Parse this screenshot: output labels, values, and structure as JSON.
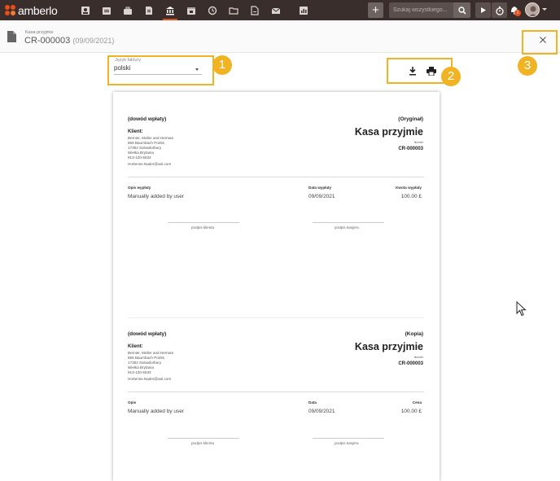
{
  "app": {
    "logo_text": "amberlo"
  },
  "topbar": {
    "nav_icons": [
      "contacts-icon",
      "matters-icon",
      "documents-icon",
      "finance-icon",
      "calendar-icon",
      "time-icon",
      "folder-icon",
      "files-icon",
      "mail-icon",
      "reports-icon"
    ],
    "active_nav": "finance-icon",
    "plus_label": "+",
    "search_placeholder": "Szukaj wszystkiego...",
    "notification_count": "1"
  },
  "header": {
    "label": "Kasa przyjmie",
    "doc_number": "CR-000003",
    "doc_date": "(09/09/2021)"
  },
  "language_select": {
    "label": "Język faktury",
    "value": "polski"
  },
  "callouts": [
    "1",
    "2",
    "3"
  ],
  "receipts": [
    {
      "kind": "(dowód wpłaty)",
      "copy": "(Oryginał)",
      "title": "Kasa przyjmie",
      "number_label": "Numer",
      "number": "CR-000003",
      "client_label": "Klient:",
      "client_lines": [
        "Bernier, Muller and Herman",
        "656 Baumbach Points",
        "17352 Salvadorbury",
        "Wielka Brytania",
        "913-120-5533",
        "Hortense.Nader@aol.com"
      ],
      "columns": [
        "Opis wypłaty",
        "Data wypłaty",
        "Kwota wypłaty"
      ],
      "values": [
        "Manually added by user",
        "09/09/2021",
        "100.00 £"
      ],
      "sig_client": "podpis klienta",
      "sig_cashier": "podpis kasjera"
    },
    {
      "kind": "(dowód wpłaty)",
      "copy": "(Kopia)",
      "title": "Kasa przyjmie",
      "number_label": "Numer",
      "number": "CR-000003",
      "client_label": "Klient:",
      "client_lines": [
        "Bernier, Muller and Herman",
        "656 Baumbach Points",
        "17352 Salvadorbury",
        "Wielka Brytania",
        "913-120-5533",
        "Hortense.Nader@aol.com"
      ],
      "columns": [
        "Opis",
        "Data",
        "Cena"
      ],
      "values": [
        "Manually added by user",
        "09/09/2021",
        "100.00 £"
      ],
      "sig_client": "podpis klienta",
      "sig_cashier": "podpis kasjera"
    }
  ]
}
